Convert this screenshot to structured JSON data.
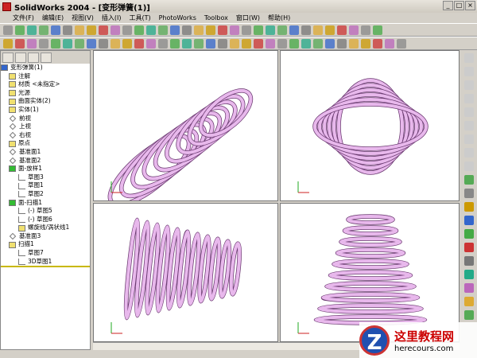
{
  "title": "SolidWorks 2004 - [变形弹簧(1)]",
  "menu": [
    "文件(F)",
    "编辑(E)",
    "视图(V)",
    "插入(I)",
    "工具(T)",
    "PhotoWorks",
    "Toolbox",
    "窗口(W)",
    "帮助(H)"
  ],
  "tree": {
    "root": "变形弹簧(1)",
    "items": [
      {
        "label": "注解",
        "icon": "annotation-icon",
        "lvl": 1
      },
      {
        "label": "材质 <未指定>",
        "icon": "material-icon",
        "lvl": 1
      },
      {
        "label": "光源",
        "icon": "lighting-icon",
        "lvl": 1
      },
      {
        "label": "曲面实体(2)",
        "icon": "surface-bodies-icon",
        "lvl": 1
      },
      {
        "label": "实体(1)",
        "icon": "solid-bodies-icon",
        "lvl": 1
      },
      {
        "label": "前视",
        "icon": "plane-icon",
        "lvl": 1
      },
      {
        "label": "上视",
        "icon": "plane-icon",
        "lvl": 1
      },
      {
        "label": "右视",
        "icon": "plane-icon",
        "lvl": 1
      },
      {
        "label": "原点",
        "icon": "origin-icon",
        "lvl": 1
      },
      {
        "label": "基准面1",
        "icon": "plane-icon",
        "lvl": 1
      },
      {
        "label": "基准面2",
        "icon": "plane-icon",
        "lvl": 1
      },
      {
        "label": "面-放样1",
        "icon": "loft-icon",
        "lvl": 1
      },
      {
        "label": "草图3",
        "icon": "sketch-icon",
        "lvl": 2
      },
      {
        "label": "草图1",
        "icon": "sketch-icon",
        "lvl": 2
      },
      {
        "label": "草图2",
        "icon": "sketch-icon",
        "lvl": 2
      },
      {
        "label": "面-扫描1",
        "icon": "sweep-surface-icon",
        "lvl": 1
      },
      {
        "label": "(-) 草图5",
        "icon": "sketch-icon",
        "lvl": 2
      },
      {
        "label": "(-) 草图6",
        "icon": "sketch-icon",
        "lvl": 2
      },
      {
        "label": "螺旋线/涡状线1",
        "icon": "helix-icon",
        "lvl": 2
      },
      {
        "label": "基准面3",
        "icon": "plane-icon",
        "lvl": 1
      },
      {
        "label": "扫描1",
        "icon": "sweep-icon",
        "lvl": 1
      },
      {
        "label": "草图7",
        "icon": "sketch-icon",
        "lvl": 2
      },
      {
        "label": "3D草图1",
        "icon": "3d-sketch-icon",
        "lvl": 2
      }
    ]
  },
  "watermark": {
    "name": "这里教程网",
    "url": "herecours.com"
  },
  "colors": {
    "spring": "#e8b8ec",
    "spring_edge": "#6a3a70"
  }
}
